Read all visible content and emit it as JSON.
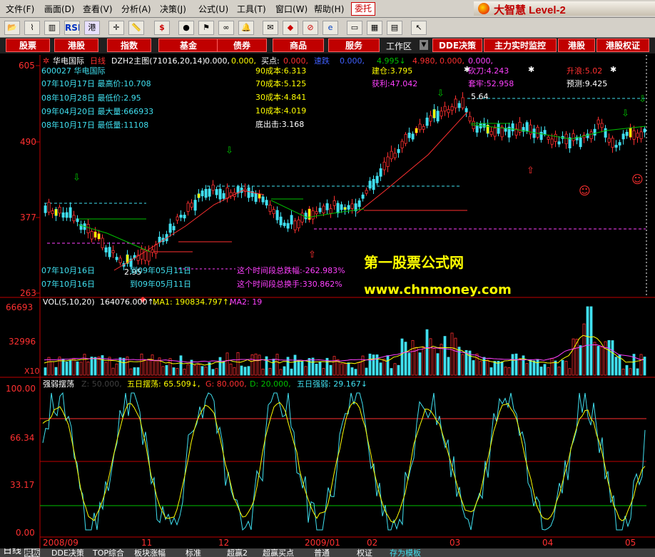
{
  "menu": {
    "items": [
      "文件(F)",
      "画面(D)",
      "查看(V)",
      "分析(A)",
      "决策(J)",
      "公式(U)",
      "工具(T)",
      "窗口(W)",
      "帮助(H)"
    ],
    "entrust": "委托",
    "brand": "大智慧 Level-2"
  },
  "toolbar": {
    "rsi_label": "RSI",
    "icons": [
      "folder-icon",
      "line-chart-icon",
      "kline-icon",
      "rsi-icon",
      "hk-icon",
      "crosshair-icon",
      "ruler-icon",
      "dollar-icon",
      "indicator-icon",
      "flag-icon",
      "binoculars-icon",
      "alert-icon",
      "news-icon",
      "diamond-icon",
      "stop-icon",
      "ie-icon",
      "note-icon",
      "table-icon",
      "grid-icon",
      "cursor-icon"
    ]
  },
  "market_bar": {
    "buttons": [
      "股票",
      "港股",
      "指数",
      "基金",
      "债券",
      "商品",
      "服务"
    ],
    "workzone": "工作区",
    "right_buttons": [
      "DDE决策",
      "主力实时监控",
      "港股",
      "港股权证"
    ]
  },
  "colors": {
    "up": "#ff3030",
    "down": "#40e0f0",
    "axis": "#c00000",
    "yellow": "#ffff00",
    "magenta": "#ff40ff",
    "green": "#00c000"
  },
  "price_panel": {
    "header": {
      "stock_name": "华电国际",
      "period": "日线",
      "formula": "DZH2主图(71016,20,14)",
      "v1": "0.000,",
      "v2": "0.000,",
      "buy_label": "买点:",
      "buy_value": "0.000,",
      "s1": "速跌",
      "s2": "0.000,",
      "s3": "4.995↓",
      "s4": "4.980,",
      "s5": "0.000,",
      "s6": "0.000,"
    },
    "stock_code": "600027 华电国际",
    "stats": [
      "07年10月17日 最高价:10.708",
      "08年10月28日 最低价:2.95",
      "09年04月20日 最大量:666933",
      "08年10月17日 最低量:11108"
    ],
    "costs": [
      "90成本:6.313",
      "70成本:5.125",
      "30成本:4.841",
      "10成本:4.019",
      "底出击:3.168"
    ],
    "build_position": "建仓:3.795",
    "profit": "获利:47.042",
    "knife": "砍刀:4.243",
    "trapped": "套牢:52.958",
    "rise": "升浪:5.02",
    "forecast": "预测:9.425",
    "peak_label": "5.64",
    "low_label": "2.95",
    "period_lines": [
      {
        "start": "07年10月16日",
        "to": "到09年05月11日",
        "text": "这个时间段总跌幅:-262.983%"
      },
      {
        "start": "07年10月16日",
        "to": "到09年05月11日",
        "text": "这个时间段总换手:330.862%"
      }
    ],
    "y_ticks": [
      "605",
      "490",
      "377",
      "263"
    ],
    "watermark_title": "第一股票公式网",
    "watermark_url": "www.chnmoney.com"
  },
  "volume_panel": {
    "header_name": "VOL(5,10,20)",
    "header_value": "164076.000↑,",
    "ma1": "MA1: 190834.797↑,",
    "ma2": "MA2: 19",
    "y_ticks": [
      "66693",
      "32996",
      "X10"
    ]
  },
  "osc_panel": {
    "name": "强弱摆荡",
    "z": "Z: 50.000,",
    "five_day": "五日摆荡: 65.509↓,",
    "g": "G: 80.000,",
    "d": "D: 20.000,",
    "five_day_strength": "五日强弱: 29.167↓",
    "y_ticks": [
      "100.00",
      "66.34",
      "33.17",
      "0.00"
    ]
  },
  "x_axis": {
    "labels": [
      "2008/09",
      "11",
      "12",
      "2009/01",
      "02",
      "03",
      "04",
      "05"
    ]
  },
  "bottom_tabs": [
    "日线",
    "指标",
    "模板",
    "DDE决策",
    "TOP综合",
    "板块涨幅",
    "标准",
    "超赢2",
    "超赢买点",
    "普通",
    "权证",
    "存为模板"
  ]
}
